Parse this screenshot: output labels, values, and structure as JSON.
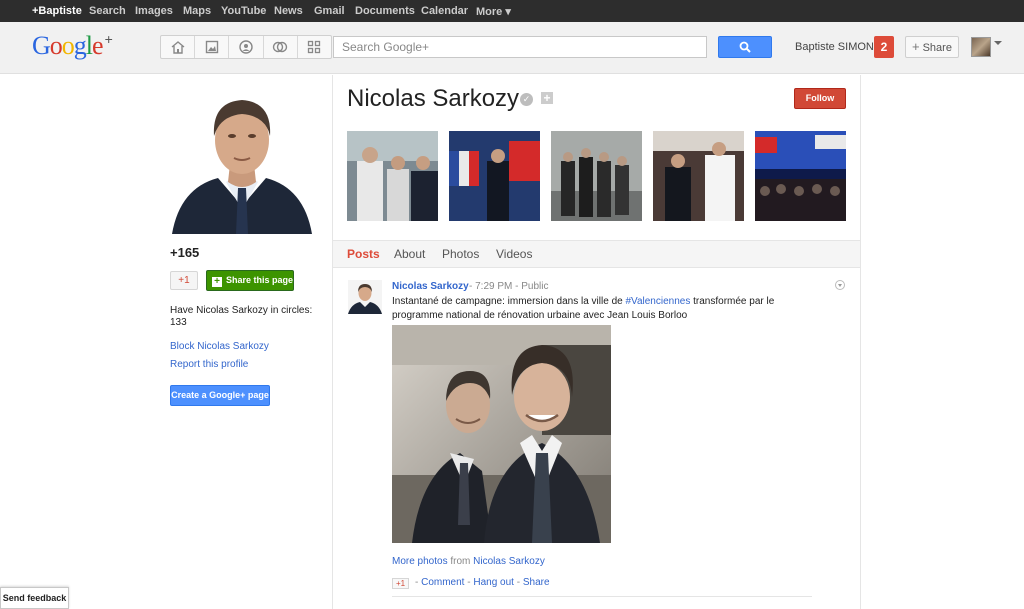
{
  "topbar": {
    "items": [
      "+Baptiste",
      "Search",
      "Images",
      "Maps",
      "YouTube",
      "News",
      "Gmail",
      "Documents",
      "Calendar",
      "More ▾"
    ]
  },
  "header": {
    "logo_text": "Google",
    "logo_plus": "+",
    "nav_icons": [
      "home-icon",
      "photos-icon",
      "profile-icon",
      "circles-icon",
      "games-icon"
    ],
    "search_placeholder": "Search Google+",
    "username": "Baptiste SIMON",
    "notifications": "2",
    "share_label": "Share"
  },
  "profile": {
    "plus_ones": "+165",
    "plus1_label": "+1",
    "share_page_label": "Share this page",
    "circles_text": "Have Nicolas Sarkozy in circles: 133",
    "block_link": "Block Nicolas Sarkozy",
    "report_link": "Report this profile",
    "create_page_label": "Create a Google+ page",
    "send_feedback": "Send feedback"
  },
  "main": {
    "name": "Nicolas Sarkozy",
    "follow_label": "Follow",
    "tabs": [
      "Posts",
      "About",
      "Photos",
      "Videos"
    ],
    "active_tab": "Posts"
  },
  "post": {
    "author": "Nicolas Sarkozy",
    "time": "7:29 PM",
    "visibility": "Public",
    "text_before": "Instantané de campagne: immersion dans la ville de ",
    "hashtag": "#Valenciennes",
    "text_after": " transformée par le programme national de rénovation urbaine avec Jean Louis Borloo",
    "more_photos": "More photos",
    "from_word": " from ",
    "from_author": "Nicolas Sarkozy",
    "plus1": "+1",
    "actions": [
      "Comment",
      "Hang out",
      "Share"
    ]
  },
  "colors": {
    "accent_blue": "#4d90fe",
    "follow_red": "#d14836",
    "share_green": "#3d9400",
    "link_blue": "#3366cc"
  }
}
